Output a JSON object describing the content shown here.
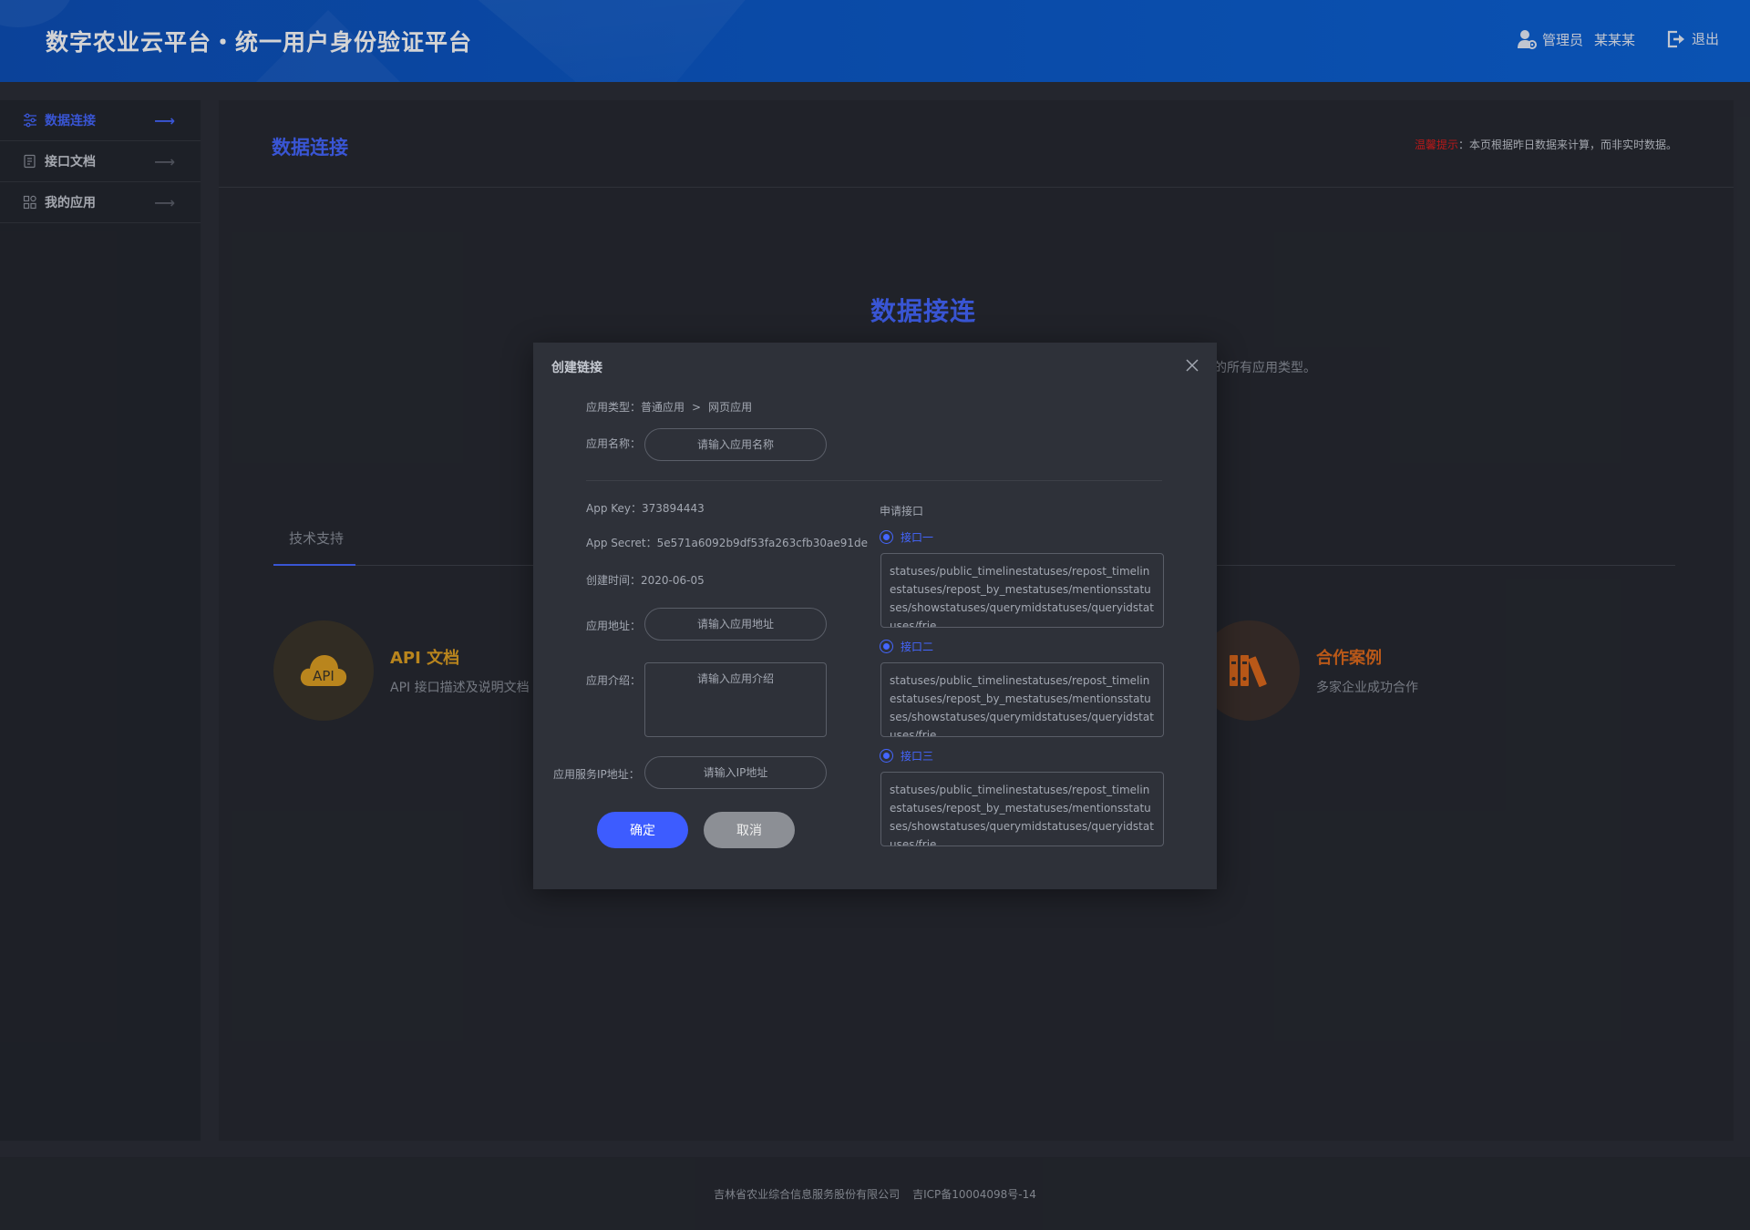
{
  "header": {
    "title": "数字农业云平台・统一用户身份验证平台",
    "user_role": "管理员",
    "user_name": "某某某",
    "logout": "退出"
  },
  "sidebar": {
    "items": [
      {
        "label": "数据连接",
        "icon": "sliders-icon",
        "active": true
      },
      {
        "label": "接口文档",
        "icon": "document-icon",
        "active": false
      },
      {
        "label": "我的应用",
        "icon": "apps-icon",
        "active": false
      }
    ]
  },
  "main": {
    "page_title": "数据连接",
    "tip_prefix": "温馨提示",
    "tip_text": "：本页根据昨日数据来计算，而非实时数据。",
    "big_title": "数据接连",
    "subdesc_visible": "的所有应用类型。",
    "tab_support": "技术支持",
    "cards": [
      {
        "title": "API 文档",
        "desc": "API 接口描述及说明文档",
        "icon": "api-cloud-icon"
      },
      {
        "title": "合作案例",
        "desc": "多家企业成功合作",
        "icon": "binders-icon"
      }
    ]
  },
  "modal": {
    "title": "创建链接",
    "type_label": "应用类型：",
    "type_value": "普通应用",
    "type_sep": ">",
    "type_sub": "网页应用",
    "name_label": "应用名称：",
    "name_placeholder": "请输入应用名称",
    "app_key_label": "App  Key：",
    "app_key": "373894443",
    "app_secret_label": "App Secret：",
    "app_secret": "5e571a6092b9df53fa263cfb30ae91de",
    "created_label": "创建时间：",
    "created": "2020-06-05",
    "url_label": "应用地址：",
    "url_placeholder": "请输入应用地址",
    "intro_label": "应用介绍：",
    "intro_placeholder": "请输入应用介绍",
    "ip_label": "应用服务IP地址：",
    "ip_placeholder": "请输入IP地址",
    "ok": "确定",
    "cancel": "取消",
    "api_head": "申请接口",
    "apis": [
      {
        "name": "接口一",
        "text": "statuses/public_timelinestatuses/repost_timelinestatuses/repost_by_mestatuses/mentionsstatuses/showstatuses/querymidstatuses/queryidstatuses/frie"
      },
      {
        "name": "接口二",
        "text": "statuses/public_timelinestatuses/repost_timelinestatuses/repost_by_mestatuses/mentionsstatuses/showstatuses/querymidstatuses/queryidstatuses/frie"
      },
      {
        "name": "接口三",
        "text": "statuses/public_timelinestatuses/repost_timelinestatuses/repost_by_mestatuses/mentionsstatuses/showstatuses/querymidstatuses/queryidstatuses/frie"
      }
    ]
  },
  "footer": {
    "company": "吉林省农业综合信息服务股份有限公司",
    "icp": "吉ICP备10004098号-14"
  },
  "colors": {
    "accent": "#4466ff",
    "header": "#0a58c8",
    "warning": "#e01c1c",
    "api_card": "#e0a020",
    "case_card": "#e06a1a"
  }
}
